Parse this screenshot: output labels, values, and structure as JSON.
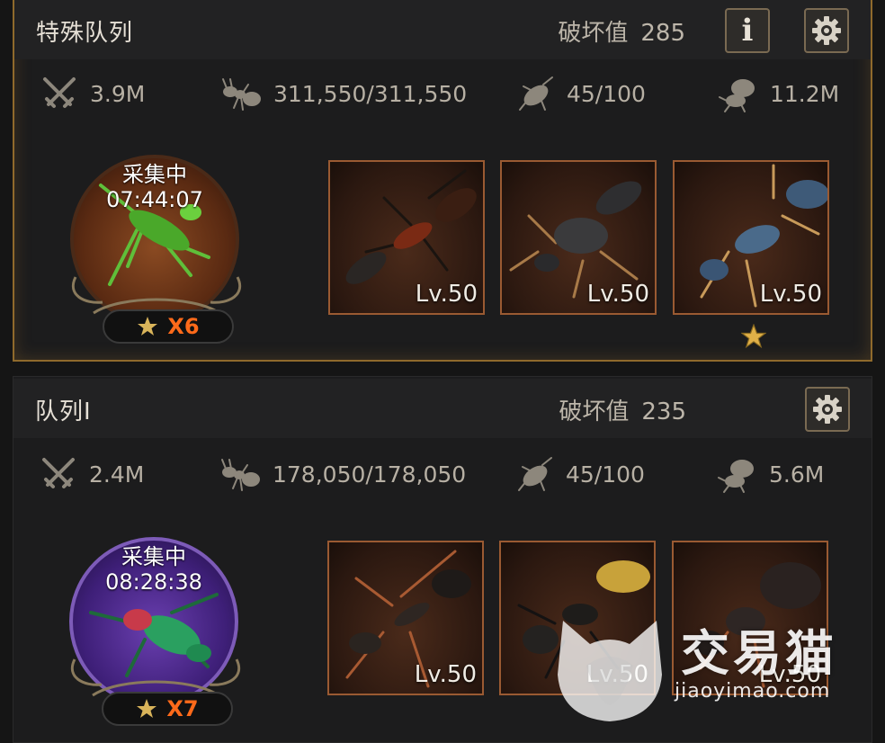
{
  "queues": [
    {
      "title": "特殊队列",
      "damage_label": "破坏值",
      "damage_value": "285",
      "has_info": true,
      "stats": {
        "attack": "3.9M",
        "ants": "311,550/311,550",
        "beetle": "45/100",
        "load": "11.2M"
      },
      "leader": {
        "status": "采集中",
        "timer": "07:44:07",
        "star_mult": "X6",
        "frame": "brown"
      },
      "troops": [
        {
          "level": "Lv.50",
          "star": false
        },
        {
          "level": "Lv.50",
          "star": false
        },
        {
          "level": "Lv.50",
          "star": true
        }
      ]
    },
    {
      "title": "队列I",
      "damage_label": "破坏值",
      "damage_value": "235",
      "has_info": false,
      "stats": {
        "attack": "2.4M",
        "ants": "178,050/178,050",
        "beetle": "45/100",
        "load": "5.6M"
      },
      "leader": {
        "status": "采集中",
        "timer": "08:28:38",
        "star_mult": "X7",
        "frame": "purple"
      },
      "troops": [
        {
          "level": "Lv.50",
          "star": false
        },
        {
          "level": "Lv.50",
          "star": false
        },
        {
          "level": "Lv.50",
          "star": false
        }
      ]
    }
  ],
  "watermark": {
    "cn": "交易猫",
    "en": "jiaoyimao.com"
  },
  "colors": {
    "accent_gold": "#8f6a2c",
    "multiplier_orange": "#ff6a1a",
    "troop_border": "#9a5a32"
  }
}
